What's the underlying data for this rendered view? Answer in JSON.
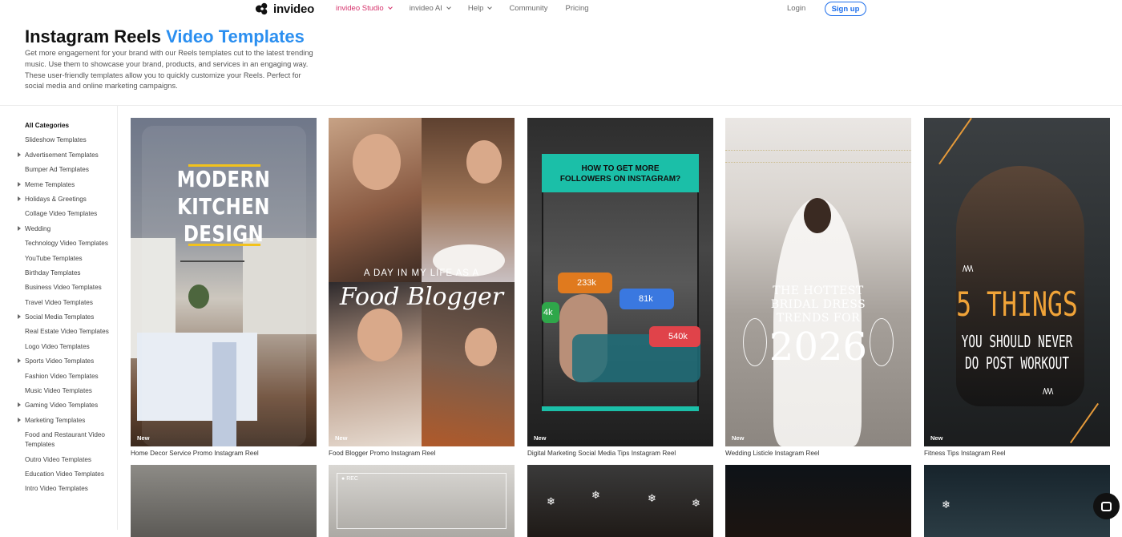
{
  "brand": {
    "name": "invideo"
  },
  "nav": {
    "links": [
      {
        "label": "invideo Studio",
        "dropdown": true,
        "active": true
      },
      {
        "label": "invideo AI",
        "dropdown": true
      },
      {
        "label": "Help",
        "dropdown": true
      },
      {
        "label": "Community"
      },
      {
        "label": "Pricing"
      }
    ],
    "login": "Login",
    "signup": "Sign up"
  },
  "header": {
    "title_main": "Instagram Reels ",
    "title_highlight": "Video Templates",
    "description": "Get more engagement for your brand with our Reels templates cut to the latest trending music. Use them to showcase your brand, products, and services in an engaging way. These user-friendly templates allow you to quickly customize your Reels. Perfect for social media and online marketing campaigns."
  },
  "sidebar": {
    "items": [
      {
        "label": "All Categories",
        "expand": false
      },
      {
        "label": "Slideshow Templates",
        "expand": false
      },
      {
        "label": "Advertisement Templates",
        "expand": true
      },
      {
        "label": "Bumper Ad Templates",
        "expand": false
      },
      {
        "label": "Meme Templates",
        "expand": true
      },
      {
        "label": "Holidays & Greetings",
        "expand": true
      },
      {
        "label": "Collage Video Templates",
        "expand": false
      },
      {
        "label": "Wedding",
        "expand": true
      },
      {
        "label": "Technology Video Templates",
        "expand": false
      },
      {
        "label": "YouTube Templates",
        "expand": false
      },
      {
        "label": "Birthday Templates",
        "expand": false
      },
      {
        "label": "Business Video Templates",
        "expand": false
      },
      {
        "label": "Travel Video Templates",
        "expand": false
      },
      {
        "label": "Social Media Templates",
        "expand": true
      },
      {
        "label": "Real Estate Video Templates",
        "expand": false
      },
      {
        "label": "Logo Video Templates",
        "expand": false
      },
      {
        "label": "Sports Video Templates",
        "expand": true
      },
      {
        "label": "Fashion Video Templates",
        "expand": false
      },
      {
        "label": "Music Video Templates",
        "expand": false
      },
      {
        "label": "Gaming Video Templates",
        "expand": true
      },
      {
        "label": "Marketing Templates",
        "expand": true
      },
      {
        "label": "Food and Restaurant Video Templates",
        "expand": false
      },
      {
        "label": "Outro Video Templates",
        "expand": false
      },
      {
        "label": "Education Video Templates",
        "expand": false
      },
      {
        "label": "Intro Video Templates",
        "expand": false
      }
    ]
  },
  "cards": [
    {
      "badge": "New",
      "caption": "Home Decor Service Promo Instagram Reel",
      "overlay": [
        "MODERN",
        "KITCHEN",
        "DESIGN"
      ]
    },
    {
      "badge": "New",
      "caption": "Food Blogger Promo Instagram Reel",
      "overlay": [
        "A DAY IN MY LIFE AS A",
        "Food Blogger"
      ]
    },
    {
      "badge": "New",
      "caption": "Digital Marketing Social Media Tips Instagram Reel",
      "overlay": [
        "HOW TO GET MORE",
        "FOLLOWERS ON INSTAGRAM?"
      ],
      "stats": [
        "233k",
        "81k",
        "540k",
        "4k"
      ]
    },
    {
      "badge": "New",
      "caption": "Wedding Listicle Instagram Reel",
      "overlay": [
        "THE HOTTEST",
        "BRIDAL DRESS",
        "TRENDS FOR",
        "2026"
      ]
    },
    {
      "badge": "New",
      "caption": "Fitness Tips Instagram Reel",
      "overlay": [
        "5 THINGS",
        "YOU SHOULD NEVER",
        "DO POST WORKOUT"
      ]
    }
  ],
  "row2": {
    "rec_label": "REC"
  },
  "colors": {
    "accent": "#2b8ff0",
    "active_nav": "#d6336c",
    "signup": "#1f6feb",
    "kitchen_bar": "#f2c21b",
    "teal": "#1bbfa8",
    "fitness_orange": "#f0a338"
  },
  "icons": {
    "logo": "invideo-logo-icon",
    "chat": "chat-icon",
    "snowflake": "snowflake-icon"
  }
}
